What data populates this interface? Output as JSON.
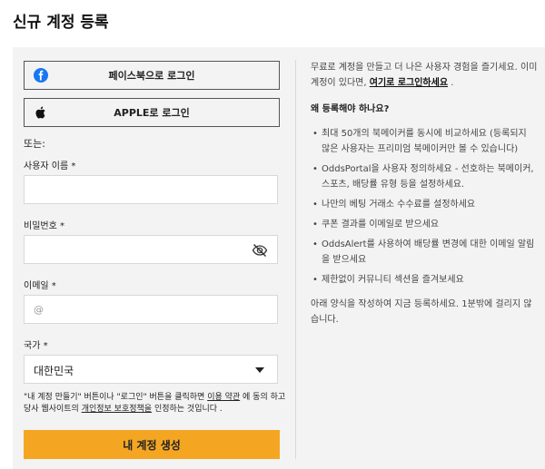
{
  "page": {
    "title": "신규 계정 등록"
  },
  "social": {
    "facebook_label": "페이스북으로 로그인",
    "apple_label": "APPLE로 로그인"
  },
  "form": {
    "or_label": "또는:",
    "username_label": "사용자 이름 *",
    "username_value": "",
    "password_label": "비밀번호 *",
    "password_value": "",
    "email_label": "이메일 *",
    "email_placeholder": "@",
    "country_label": "국가 *",
    "country_value": "대한민국",
    "terms_prefix": "\"내 계정 만들기\" 버튼이나 \"로그인\" 버튼을 클릭하면 ",
    "terms_link": "이용 약관",
    "terms_mid": " 에 동의 하고 당사 웹사이트의 ",
    "privacy_link": "개인정보 보호정책을",
    "terms_suffix": " 인정하는 것입니다 .",
    "create_label": "내 계정 생성"
  },
  "info": {
    "intro_text": "무료로 계정을 만들고 더 나은 사용자 경험을 즐기세요. 이미 계정이 있다면, ",
    "intro_link": "여기로 로그인하세요",
    "intro_end": " .",
    "why_title": "왜 등록해야 하나요?",
    "benefits": [
      "최대 50개의 북메이커를 동시에 비교하세요 (등록되지 않은 사용자는 프리미엄 북메이커만 볼 수 있습니다)",
      "OddsPortal을 사용자 정의하세요 - 선호하는 북메이커, 스포츠, 배당률 유형 등을 설정하세요.",
      "나만의 베팅 거래소 수수료를 설정하세요",
      "쿠폰 결과를 이메일로 받으세요",
      "OddsAlert를 사용하여 배당률 변경에 대한 이메일 알림을 받으세요",
      "제한없이 커뮤니티 섹션을 즐겨보세요"
    ],
    "outro": "아래 양식을 작성하여 지금 등록하세요. 1분밖에 걸리지 않습니다."
  }
}
